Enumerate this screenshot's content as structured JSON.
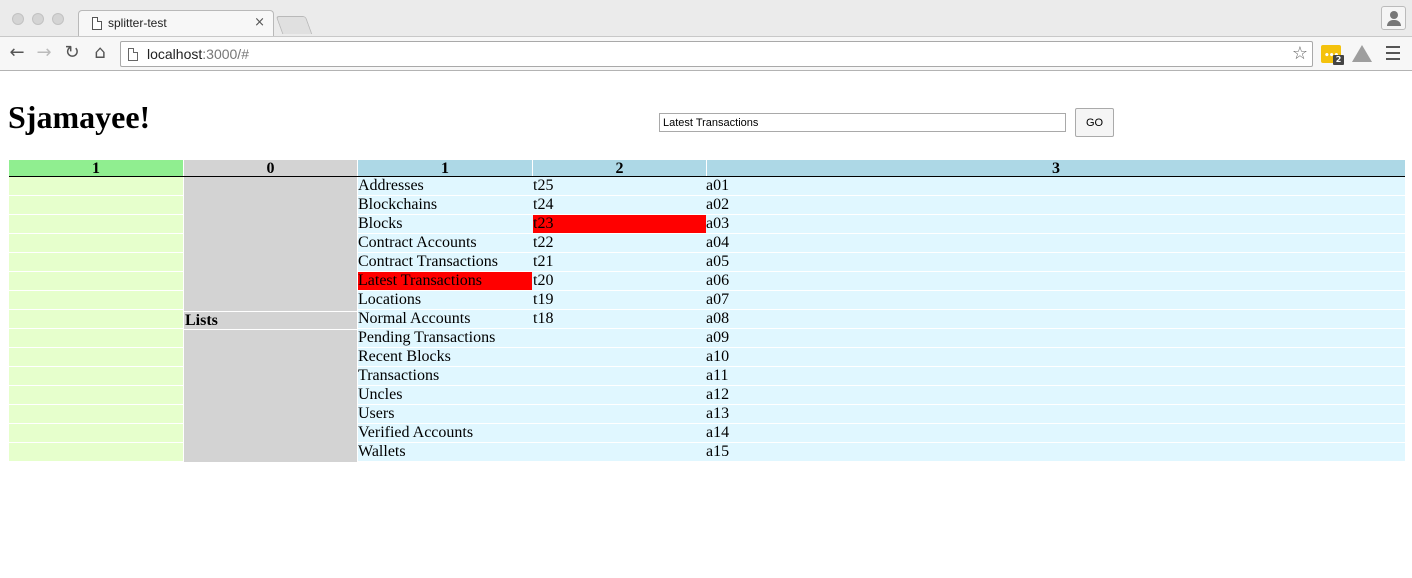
{
  "browser": {
    "tab_title": "splitter-test",
    "tab_close": "×",
    "url_host": "localhost",
    "url_rest": ":3000/#",
    "extension_badge": "2",
    "extension_dots": "•••"
  },
  "page": {
    "title": "Sjamayee!",
    "search_value": "Latest Transactions",
    "go_label": "GO"
  },
  "columns": {
    "headers": [
      {
        "label": "1",
        "color": "#90ee90"
      },
      {
        "label": "0",
        "color": "#d3d3d3"
      },
      {
        "label": "1",
        "color": "#add8e6"
      },
      {
        "label": "2",
        "color": "#add8e6"
      },
      {
        "label": "3",
        "color": "#add8e6"
      }
    ]
  },
  "col0": {
    "label": "Lists"
  },
  "rows": [
    {
      "list": "Addresses",
      "tx": "t25",
      "acc": "a01"
    },
    {
      "list": "Blockchains",
      "tx": "t24",
      "acc": "a02"
    },
    {
      "list": "Blocks",
      "tx": "t23",
      "acc": "a03"
    },
    {
      "list": "Contract Accounts",
      "tx": "t22",
      "acc": "a04"
    },
    {
      "list": "Contract Transactions",
      "tx": "t21",
      "acc": "a05"
    },
    {
      "list": "Latest Transactions",
      "tx": "t20",
      "acc": "a06"
    },
    {
      "list": "Locations",
      "tx": "t19",
      "acc": "a07"
    },
    {
      "list": "Normal Accounts",
      "tx": "t18",
      "acc": "a08"
    },
    {
      "list": "Pending Transactions",
      "tx": "",
      "acc": "a09"
    },
    {
      "list": "Recent Blocks",
      "tx": "",
      "acc": "a10"
    },
    {
      "list": "Transactions",
      "tx": "",
      "acc": "a11"
    },
    {
      "list": "Uncles",
      "tx": "",
      "acc": "a12"
    },
    {
      "list": "Users",
      "tx": "",
      "acc": "a13"
    },
    {
      "list": "Verified Accounts",
      "tx": "",
      "acc": "a14"
    },
    {
      "list": "Wallets",
      "tx": "",
      "acc": "a15"
    }
  ],
  "selection": {
    "list_row": 5,
    "tx_row": 2,
    "highlight_color": "#ff0000"
  }
}
